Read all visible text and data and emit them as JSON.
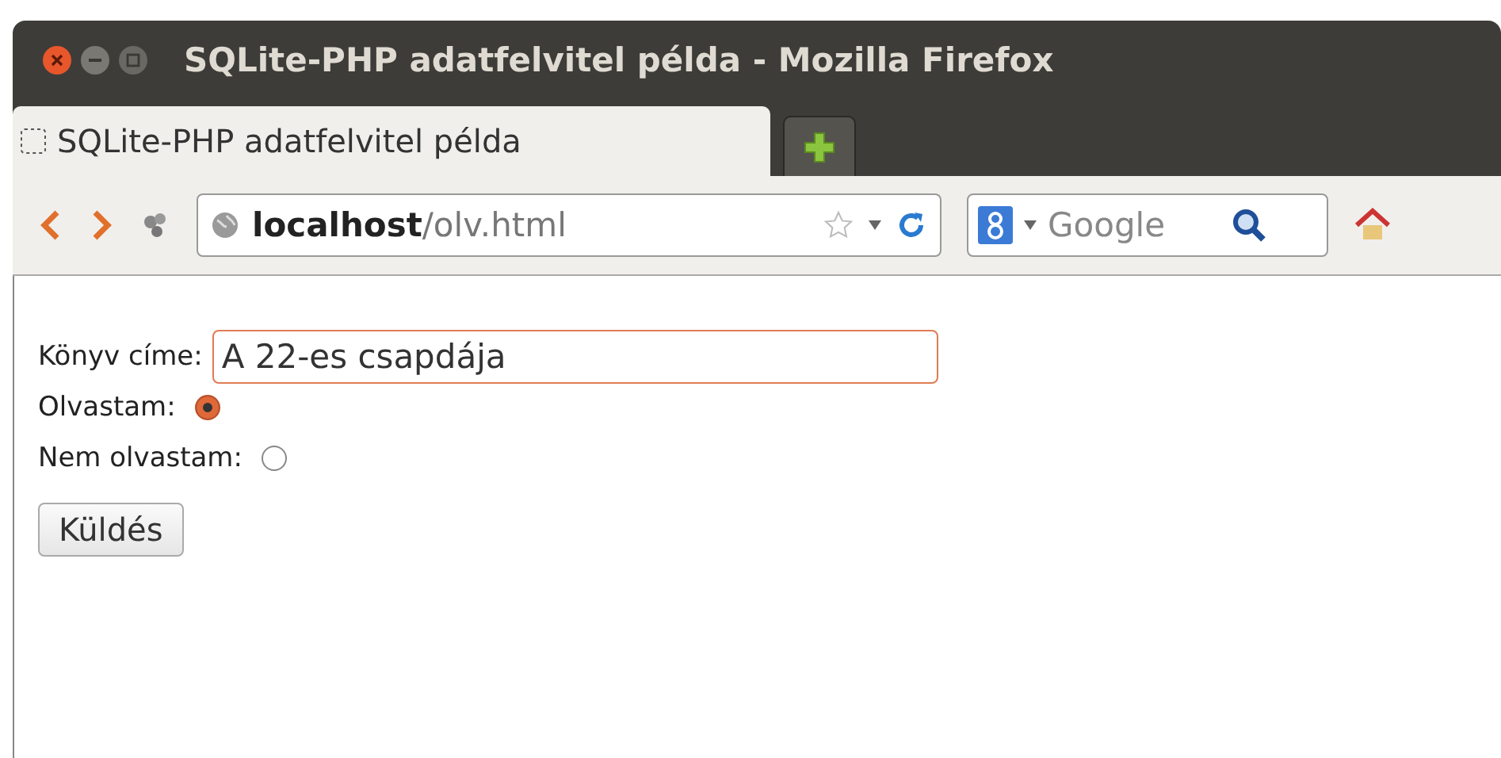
{
  "window": {
    "title": "SQLite-PHP adatfelvitel példa - Mozilla Firefox"
  },
  "tabs": [
    {
      "label": "SQLite-PHP adatfelvitel példa",
      "selected": true
    }
  ],
  "toolbar": {
    "url_host": "localhost",
    "url_path": "/olv.html",
    "search_placeholder": "Google"
  },
  "form": {
    "title_label": "Könyv címe:",
    "title_value": "A 22-es csapdája",
    "title_focused": true,
    "radios": [
      {
        "label": "Olvastam:",
        "selected": true
      },
      {
        "label": "Nem olvastam:",
        "selected": false
      }
    ],
    "submit": "Küldés"
  }
}
